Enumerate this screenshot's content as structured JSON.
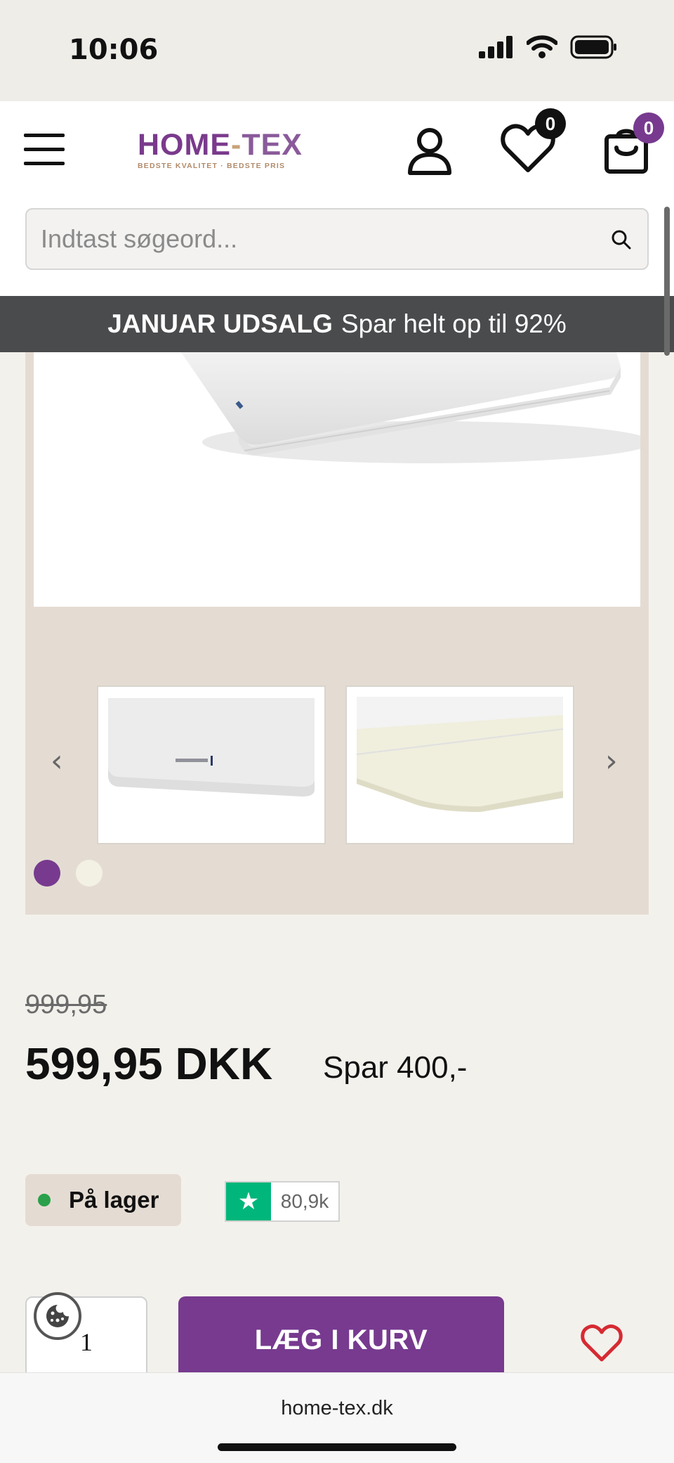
{
  "status_bar": {
    "time": "10:06"
  },
  "header": {
    "logo_main": "HOME",
    "logo_dash": "-",
    "logo_tex": "TEX",
    "logo_tagline": "BEDSTE KVALITET · BEDSTE PRIS",
    "wishlist_count": "0",
    "cart_count": "0",
    "search_placeholder": "Indtast søgeord..."
  },
  "promo": {
    "bold": "JANUAR UDSALG",
    "text": "Spar helt op til 92%"
  },
  "gallery": {
    "prev_arrow": "‹",
    "next_arrow": "›",
    "thumbnail_count": 2,
    "active_dot": 0
  },
  "product": {
    "old_price": "999,95",
    "price": "599,95 DKK",
    "savings": "Spar 400,-",
    "stock_label": "På lager",
    "trustpilot_count": "80,9k",
    "quantity": "1",
    "add_to_cart_label": "LÆG I KURV"
  },
  "browser": {
    "url": "home-tex.dk"
  },
  "colors": {
    "brand_purple": "#773a8f",
    "promo_bg": "#4a4b4d",
    "stock_green": "#2aa04a",
    "trustpilot_green": "#00b67a",
    "gallery_bg": "#e4dcd3",
    "wishlist_red": "#d62a32"
  },
  "icons": {
    "menu": "hamburger-icon",
    "account": "user-icon",
    "wishlist": "heart-icon",
    "cart": "shopping-bag-icon",
    "search": "search-icon",
    "trustpilot": "star-icon",
    "cookie": "cookie-icon"
  }
}
